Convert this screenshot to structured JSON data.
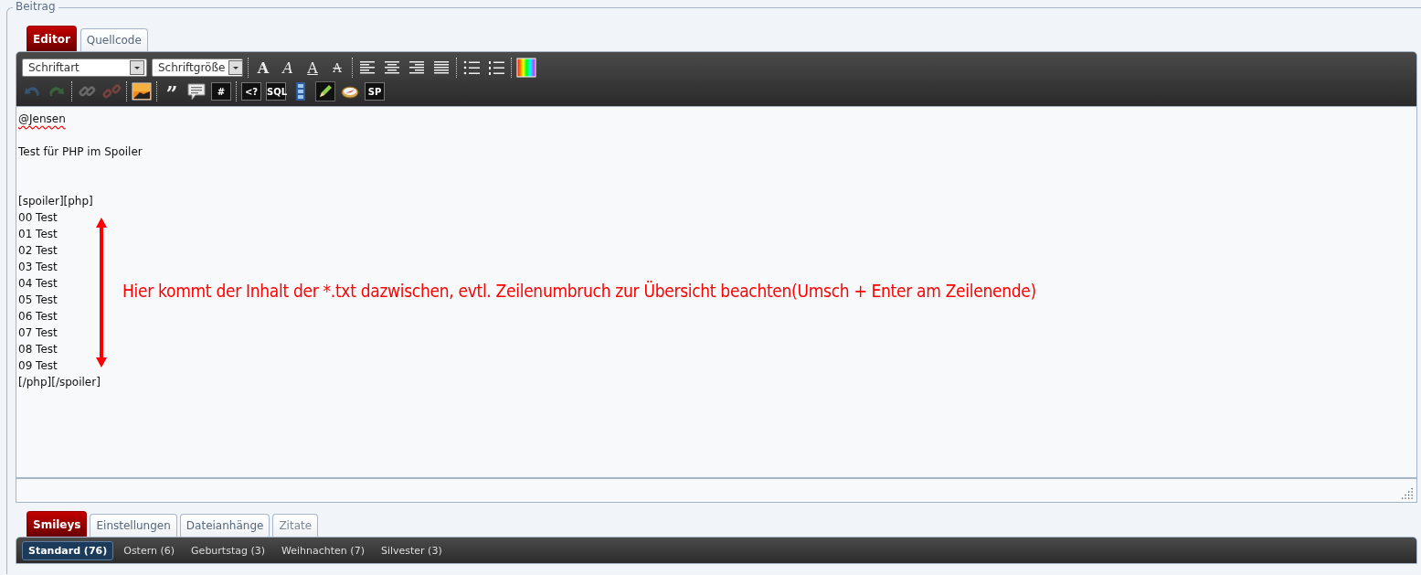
{
  "legend": "Beitrag",
  "editor_tabs": [
    {
      "label": "Editor",
      "selected": true,
      "disabled": false
    },
    {
      "label": "Quellcode",
      "selected": false,
      "disabled": false
    }
  ],
  "toolbar_rows": [
    [
      {
        "kind": "select",
        "label": "Schriftart",
        "disabled": false
      },
      {
        "kind": "select",
        "label": "Schriftgröße",
        "disabled": false
      },
      {
        "kind": "sep",
        "disabled": false
      },
      {
        "kind": "bold",
        "label": "A",
        "disabled": false
      },
      {
        "kind": "italic",
        "label": "A",
        "disabled": false
      },
      {
        "kind": "underline",
        "label": "A",
        "disabled": false
      },
      {
        "kind": "strike",
        "label": "A",
        "disabled": false
      },
      {
        "kind": "sep",
        "disabled": false
      },
      {
        "kind": "align-left",
        "disabled": false
      },
      {
        "kind": "align-center",
        "disabled": false
      },
      {
        "kind": "align-right",
        "disabled": false
      },
      {
        "kind": "justify",
        "disabled": false
      },
      {
        "kind": "sep",
        "disabled": false
      },
      {
        "kind": "bullets",
        "disabled": false
      },
      {
        "kind": "numbers",
        "disabled": false
      },
      {
        "kind": "sep",
        "disabled": false
      },
      {
        "kind": "color",
        "disabled": false
      }
    ],
    [
      {
        "kind": "undo",
        "disabled": true
      },
      {
        "kind": "redo",
        "disabled": true
      },
      {
        "kind": "sep",
        "disabled": false
      },
      {
        "kind": "link",
        "disabled": true
      },
      {
        "kind": "unlink",
        "disabled": true
      },
      {
        "kind": "sep",
        "disabled": false
      },
      {
        "kind": "image",
        "disabled": false
      },
      {
        "kind": "sep",
        "disabled": false
      },
      {
        "kind": "quote",
        "label": "”",
        "disabled": false
      },
      {
        "kind": "bubble",
        "disabled": false
      },
      {
        "kind": "code",
        "label": "#",
        "disabled": false
      },
      {
        "kind": "sep",
        "disabled": false
      },
      {
        "kind": "code",
        "label": "<?",
        "disabled": false
      },
      {
        "kind": "code",
        "label": "SQL",
        "disabled": false
      },
      {
        "kind": "film",
        "disabled": false
      },
      {
        "kind": "pencil",
        "disabled": false
      },
      {
        "kind": "compass",
        "disabled": false
      },
      {
        "kind": "code",
        "label": "SP",
        "disabled": false
      }
    ]
  ],
  "lines": [
    {
      "kind": "text",
      "text": "@Jensen",
      "misspelled": true
    },
    {
      "kind": "blank"
    },
    {
      "kind": "text",
      "text": "Test für PHP im Spoiler",
      "misspelled": false
    },
    {
      "kind": "blank"
    },
    {
      "kind": "blank"
    },
    {
      "kind": "text",
      "text": "[spoiler][php]",
      "misspelled": false
    },
    {
      "kind": "text",
      "text": "00 Test",
      "misspelled": false
    },
    {
      "kind": "text",
      "text": "01 Test",
      "misspelled": false
    },
    {
      "kind": "text",
      "text": "02 Test",
      "misspelled": false
    },
    {
      "kind": "text",
      "text": "03 Test",
      "misspelled": false
    },
    {
      "kind": "text",
      "text": "04 Test",
      "misspelled": false
    },
    {
      "kind": "text",
      "text": "05 Test",
      "misspelled": false
    },
    {
      "kind": "text",
      "text": "06 Test",
      "misspelled": false
    },
    {
      "kind": "text",
      "text": "07 Test",
      "misspelled": false
    },
    {
      "kind": "text",
      "text": "08 Test",
      "misspelled": false
    },
    {
      "kind": "text",
      "text": "09 Test",
      "misspelled": false
    },
    {
      "kind": "text",
      "text": "[/php][/spoiler]",
      "misspelled": false
    }
  ],
  "annotation": {
    "text": "Hier kommt der Inhalt der *.txt dazwischen, evtl. Zeilenumbruch zur Übersicht beachten(Umsch + Enter am Zeilenende)"
  },
  "bottom_tabs": [
    {
      "label": "Smileys",
      "selected": true,
      "disabled": false
    },
    {
      "label": "Einstellungen",
      "selected": false,
      "disabled": false
    },
    {
      "label": "Dateianhänge",
      "selected": false,
      "disabled": false
    },
    {
      "label": "Zitate",
      "selected": false,
      "disabled": true
    }
  ],
  "smiley_categories": [
    {
      "label": "Standard (76)",
      "selected": true
    },
    {
      "label": "Ostern (6)",
      "selected": false
    },
    {
      "label": "Geburtstag (3)",
      "selected": false
    },
    {
      "label": "Weihnachten (7)",
      "selected": false
    },
    {
      "label": "Silvester (3)",
      "selected": false
    }
  ]
}
